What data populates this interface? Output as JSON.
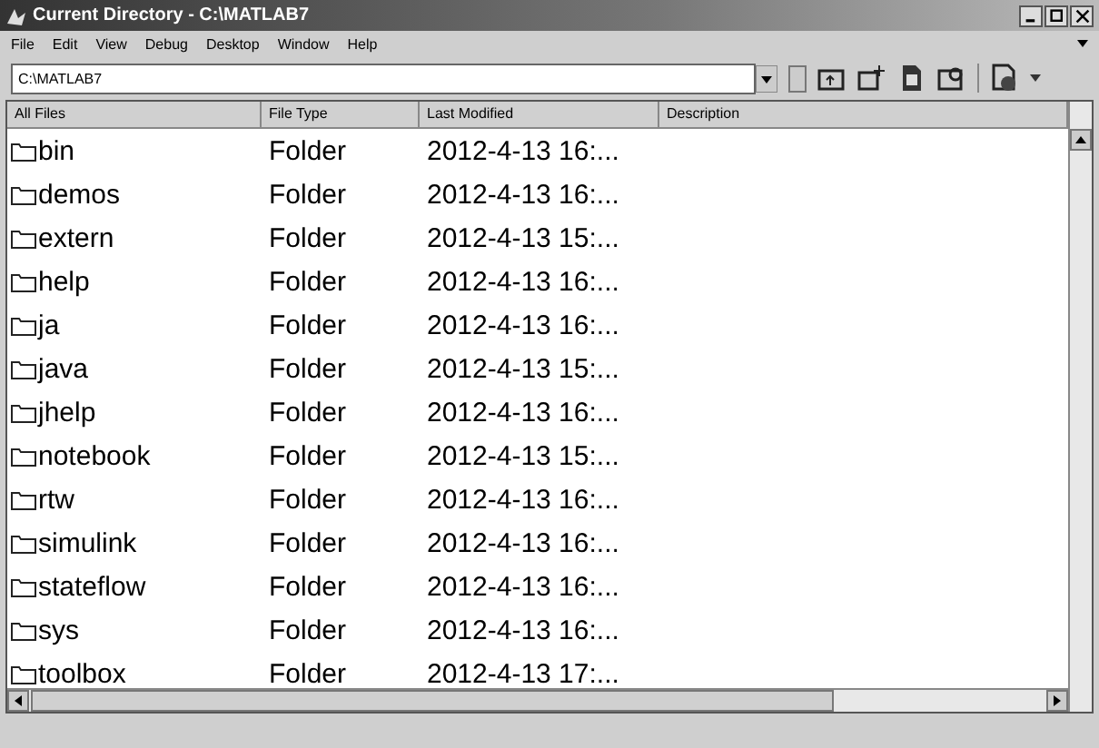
{
  "window": {
    "title": "Current Directory - C:\\MATLAB7"
  },
  "menu": [
    "File",
    "Edit",
    "View",
    "Debug",
    "Desktop",
    "Window",
    "Help"
  ],
  "path_field": {
    "value": "C:\\MATLAB7"
  },
  "table": {
    "columns": [
      "All Files",
      "File Type",
      "Last Modified",
      "Description"
    ],
    "rows": [
      {
        "name": "bin",
        "type": "Folder",
        "modified": "2012-4-13 16:..."
      },
      {
        "name": "demos",
        "type": "Folder",
        "modified": "2012-4-13 16:..."
      },
      {
        "name": "extern",
        "type": "Folder",
        "modified": "2012-4-13 15:..."
      },
      {
        "name": "help",
        "type": "Folder",
        "modified": "2012-4-13 16:..."
      },
      {
        "name": "ja",
        "type": "Folder",
        "modified": "2012-4-13 16:..."
      },
      {
        "name": "java",
        "type": "Folder",
        "modified": "2012-4-13 15:..."
      },
      {
        "name": "jhelp",
        "type": "Folder",
        "modified": "2012-4-13 16:..."
      },
      {
        "name": "notebook",
        "type": "Folder",
        "modified": "2012-4-13 15:..."
      },
      {
        "name": "rtw",
        "type": "Folder",
        "modified": "2012-4-13 16:..."
      },
      {
        "name": "simulink",
        "type": "Folder",
        "modified": "2012-4-13 16:..."
      },
      {
        "name": "stateflow",
        "type": "Folder",
        "modified": "2012-4-13 16:..."
      },
      {
        "name": "sys",
        "type": "Folder",
        "modified": "2012-4-13 16:..."
      },
      {
        "name": "toolbox",
        "type": "Folder",
        "modified": "2012-4-13 17:..."
      }
    ]
  }
}
